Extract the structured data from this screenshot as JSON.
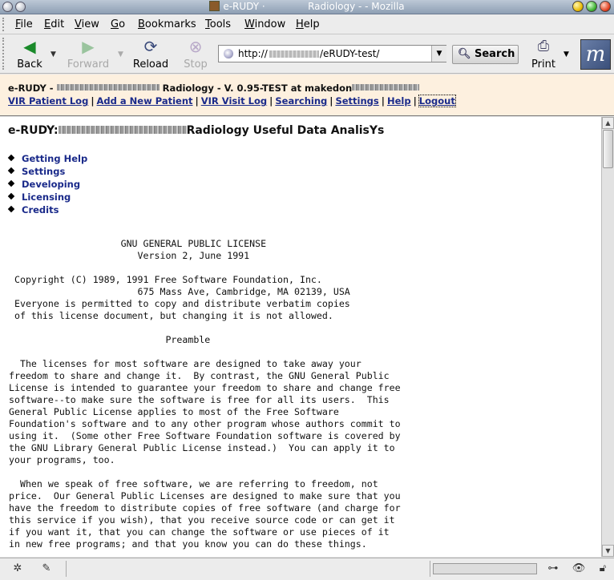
{
  "window": {
    "title": "e-RUDY ·              Radiology - - Mozilla"
  },
  "menu": {
    "items": [
      "File",
      "Edit",
      "View",
      "Go",
      "Bookmarks",
      "Tools",
      "Window",
      "Help"
    ]
  },
  "nav": {
    "back": "Back",
    "forward": "Forward",
    "reload": "Reload",
    "stop": "Stop",
    "url_prefix": "http://",
    "url_suffix": "/eRUDY-test/",
    "search": "Search",
    "print": "Print"
  },
  "header": {
    "title_prefix": "e-RUDY -",
    "title_middle": "Radiology - V. 0.95-TEST at makedon",
    "links": [
      "VIR Patient Log",
      "Add a New Patient",
      "VIR Visit Log",
      "Searching",
      "Settings",
      "Help",
      "Logout"
    ]
  },
  "page": {
    "title_prefix": "e-RUDY:",
    "title_suffix": "Radiology Useful Data AnalisYs",
    "toc": [
      "Getting Help",
      "Settings",
      "Developing",
      "Licensing",
      "Credits"
    ],
    "license_text": "                    GNU GENERAL PUBLIC LICENSE\n                       Version 2, June 1991\n\n Copyright (C) 1989, 1991 Free Software Foundation, Inc.\n                       675 Mass Ave, Cambridge, MA 02139, USA\n Everyone is permitted to copy and distribute verbatim copies\n of this license document, but changing it is not allowed.\n\n                            Preamble\n\n  The licenses for most software are designed to take away your\nfreedom to share and change it.  By contrast, the GNU General Public\nLicense is intended to guarantee your freedom to share and change free\nsoftware--to make sure the software is free for all its users.  This\nGeneral Public License applies to most of the Free Software\nFoundation's software and to any other program whose authors commit to\nusing it.  (Some other Free Software Foundation software is covered by\nthe GNU Library General Public License instead.)  You can apply it to\nyour programs, too.\n\n  When we speak of free software, we are referring to freedom, not\nprice.  Our General Public Licenses are designed to make sure that you\nhave the freedom to distribute copies of free software (and charge for\nthis service if you wish), that you receive source code or can get it\nif you want it, that you can change the software or use pieces of it\nin new free programs; and that you know you can do these things."
  },
  "colors": {
    "link": "#1a2a8a",
    "header_band": "#fdf0df"
  }
}
